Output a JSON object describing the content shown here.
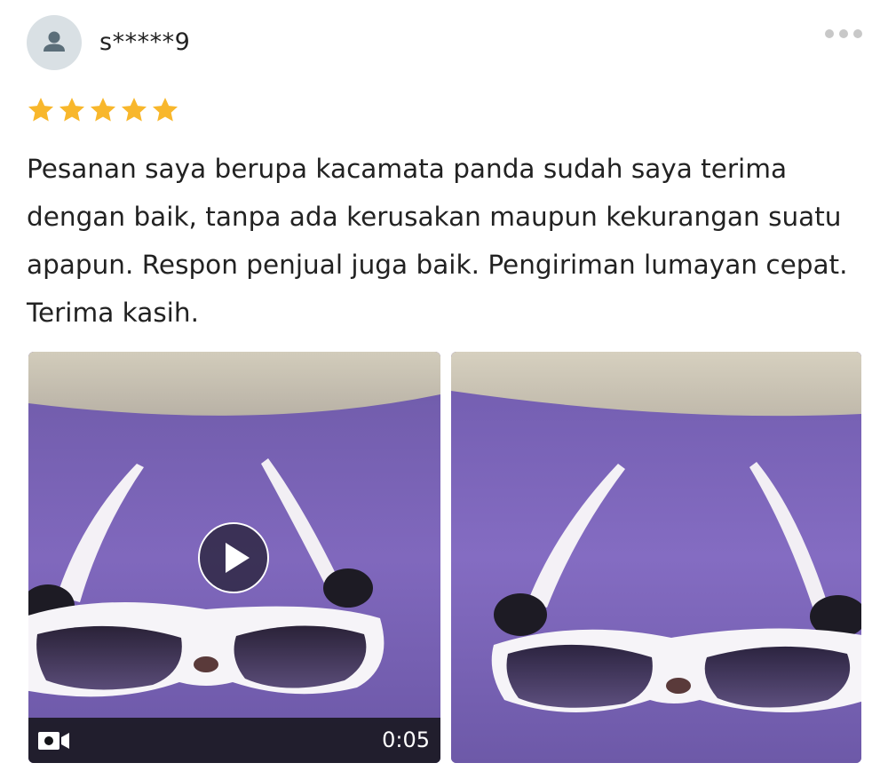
{
  "review": {
    "username": "s*****9",
    "rating": 5,
    "rating_max": 5,
    "text": "Pesanan saya berupa kacamata panda sudah saya terima dengan baik, tanpa ada kerusakan maupun kekurangan suatu apapun. Respon penjual juga baik. Pengiriman lumayan cepat. Terima kasih."
  },
  "icons": {
    "avatar": "user-icon",
    "more": "more-dots-icon",
    "star": "star-icon",
    "play": "play-icon",
    "video": "video-camera-icon"
  },
  "media": {
    "video_duration": "0:05"
  },
  "colors": {
    "star": "#f8b72c",
    "avatar_bg": "#d9e0e4",
    "avatar_fg": "#5b6e79",
    "text": "#222222",
    "more_dots": "#c8c8c8",
    "video_bar": "#141418"
  }
}
